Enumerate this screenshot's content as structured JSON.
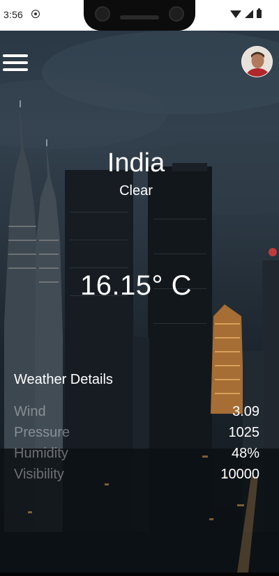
{
  "status_bar": {
    "time": "3:56"
  },
  "header": {
    "menu_icon": "hamburger-menu-icon",
    "avatar_icon": "user-avatar"
  },
  "weather": {
    "city": "India",
    "condition": "Clear",
    "temperature": "16.15° C"
  },
  "details": {
    "title": "Weather Details",
    "rows": [
      {
        "label": "Wind",
        "value": "3.09"
      },
      {
        "label": "Pressure",
        "value": "1025"
      },
      {
        "label": "Humidity",
        "value": "48%"
      },
      {
        "label": "Visibility",
        "value": "10000"
      }
    ]
  },
  "colors": {
    "status_bar_bg": "#ffffff",
    "text_primary": "#ffffff",
    "label_muted": "rgba(255,255,255,0.38)"
  }
}
